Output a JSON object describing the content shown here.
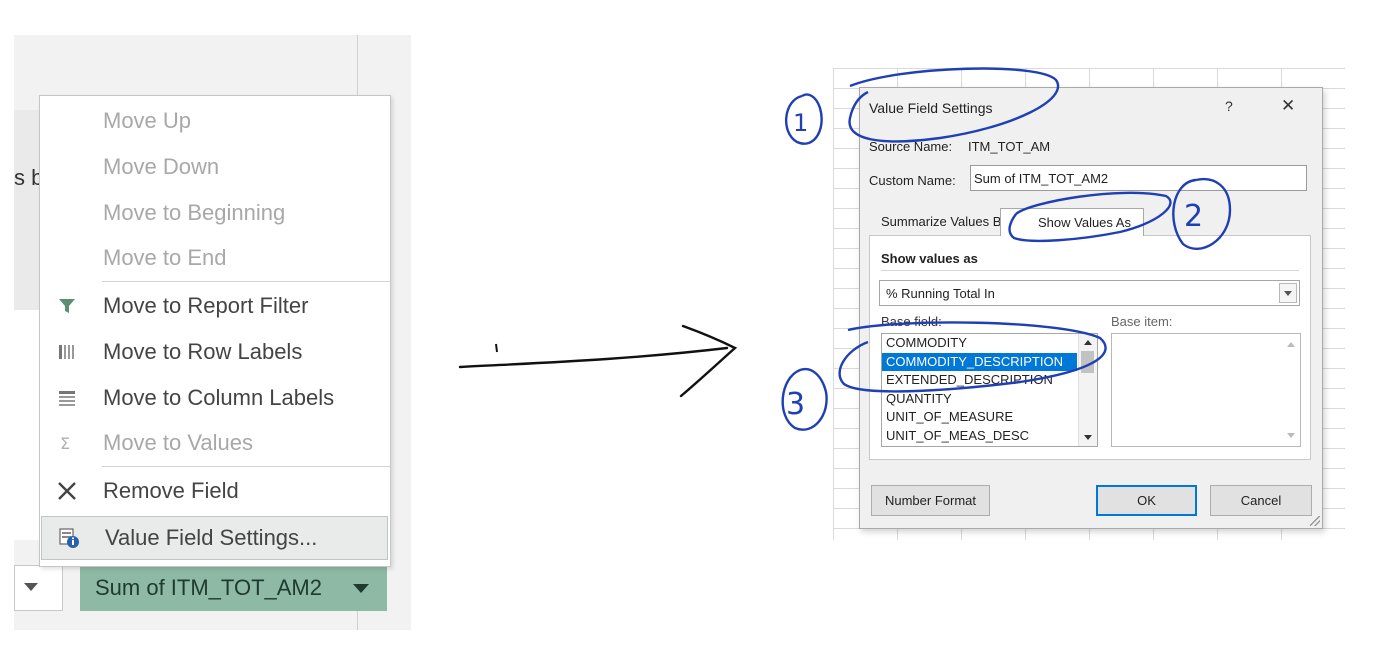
{
  "left": {
    "cut_text": "s b",
    "menu": [
      {
        "label": "Move Up",
        "disabled": true,
        "icon": null
      },
      {
        "label": "Move Down",
        "disabled": true,
        "icon": null
      },
      {
        "label": "Move to Beginning",
        "disabled": true,
        "icon": null
      },
      {
        "label": "Move to End",
        "disabled": true,
        "icon": null
      },
      {
        "label": "Move to Report Filter",
        "disabled": false,
        "icon": "filter-icon"
      },
      {
        "label": "Move to Row Labels",
        "disabled": false,
        "icon": "row-labels-icon"
      },
      {
        "label": "Move to Column Labels",
        "disabled": false,
        "icon": "column-labels-icon"
      },
      {
        "label": "Move to Values",
        "disabled": true,
        "icon": "sigma-icon"
      },
      {
        "label": "Remove Field",
        "disabled": false,
        "icon": "remove-x-icon"
      },
      {
        "label": "Value Field Settings...",
        "disabled": false,
        "icon": "value-field-settings-icon",
        "highlighted": true
      }
    ],
    "sum_pill_label": "Sum of ITM_TOT_AM2"
  },
  "dialog": {
    "title": "Value Field Settings",
    "help": "?",
    "close": "✕",
    "source_name_label": "Source Name:",
    "source_name_value": "ITM_TOT_AM",
    "custom_name_label": "Custom Name:",
    "custom_name_value": "Sum of ITM_TOT_AM2",
    "tab_summarize": "Summarize Values By",
    "tab_show_values": "Show Values As",
    "show_values_heading": "Show values as",
    "show_values_selected": "% Running Total In",
    "base_field_label": "Base field:",
    "base_item_label": "Base item:",
    "base_fields": [
      "COMMODITY",
      "COMMODITY_DESCRIPTION",
      "EXTENDED_DESCRIPTION",
      "QUANTITY",
      "UNIT_OF_MEASURE",
      "UNIT_OF_MEAS_DESC"
    ],
    "base_field_selected": "COMMODITY_DESCRIPTION",
    "number_format_button": "Number Format",
    "ok_button": "OK",
    "cancel_button": "Cancel"
  },
  "annotations": {
    "marks": [
      "1",
      "2",
      "3"
    ],
    "ink_color": "#1f3fb5"
  }
}
